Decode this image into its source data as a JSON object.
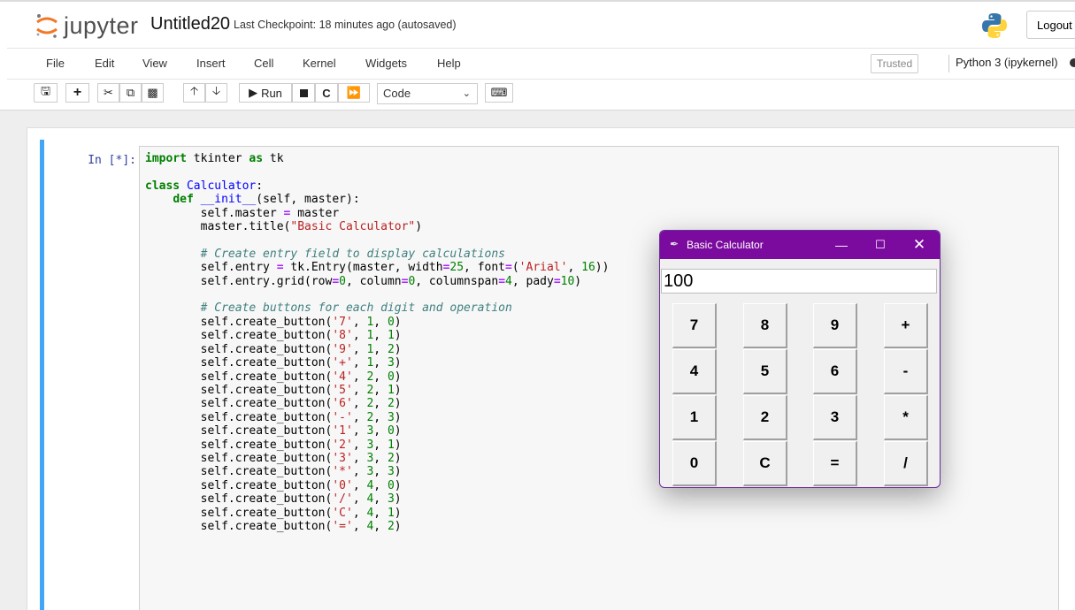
{
  "header": {
    "logo_text": "jupyter",
    "notebook_name": "Untitled20",
    "checkpoint": "Last Checkpoint: 18 minutes ago  (autosaved)",
    "logout_label": "Logout"
  },
  "menu": {
    "items": [
      "File",
      "Edit",
      "View",
      "Insert",
      "Cell",
      "Kernel",
      "Widgets",
      "Help"
    ],
    "trusted_label": "Trusted",
    "kernel_name": "Python 3 (ipykernel)"
  },
  "toolbar": {
    "run_label": "Run",
    "cell_type": "Code"
  },
  "cell": {
    "prompt": "In [*]:",
    "code_lines": [
      "import tkinter as tk",
      "",
      "class Calculator:",
      "    def __init__(self, master):",
      "        self.master = master",
      "        master.title(\"Basic Calculator\")",
      "",
      "        # Create entry field to display calculations",
      "        self.entry = tk.Entry(master, width=25, font=('Arial', 16))",
      "        self.entry.grid(row=0, column=0, columnspan=4, pady=10)",
      "",
      "        # Create buttons for each digit and operation",
      "        self.create_button('7', 1, 0)",
      "        self.create_button('8', 1, 1)",
      "        self.create_button('9', 1, 2)",
      "        self.create_button('+', 1, 3)",
      "        self.create_button('4', 2, 0)",
      "        self.create_button('5', 2, 1)",
      "        self.create_button('6', 2, 2)",
      "        self.create_button('-', 2, 3)",
      "        self.create_button('1', 3, 0)",
      "        self.create_button('2', 3, 1)",
      "        self.create_button('3', 3, 2)",
      "        self.create_button('*', 3, 3)",
      "        self.create_button('0', 4, 0)",
      "        self.create_button('/', 4, 3)",
      "        self.create_button('C', 4, 1)",
      "        self.create_button('=', 4, 2)"
    ]
  },
  "calculator": {
    "title": "Basic Calculator",
    "entry_value": "100",
    "rows": [
      [
        "7",
        "8",
        "9",
        "+"
      ],
      [
        "4",
        "5",
        "6",
        "-"
      ],
      [
        "1",
        "2",
        "3",
        "*"
      ],
      [
        "0",
        "C",
        "=",
        "/"
      ]
    ]
  },
  "colors": {
    "cell_accent": "#42a5f5",
    "calc_titlebar": "#7b0a9e"
  }
}
